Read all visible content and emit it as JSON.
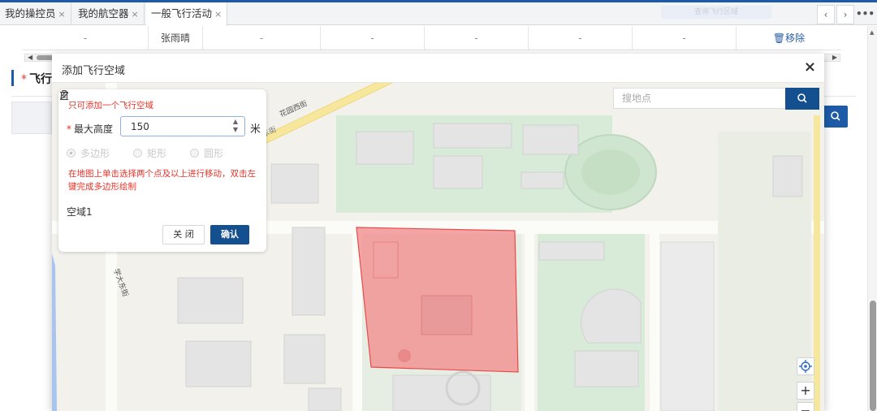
{
  "tabs": [
    {
      "label": "我的操控员",
      "close": "×"
    },
    {
      "label": "我的航空器",
      "close": "×"
    },
    {
      "label": "一般飞行活动",
      "close": "×",
      "active": true
    }
  ],
  "tab_nav": {
    "prev": "‹",
    "next": "›",
    "more": "•••"
  },
  "header_ghost_button": "查询飞行区域",
  "background_table": {
    "row": [
      "-",
      "张雨晴",
      "-",
      "-",
      "-",
      "-",
      "-"
    ],
    "remove_label": "移除"
  },
  "section_title": {
    "required": "*",
    "text": "飞行"
  },
  "modal": {
    "title": "添加飞行空域",
    "close": "×",
    "map_search_placeholder": "搜地点",
    "panel": {
      "hint_single": "只可添加一个飞行空域",
      "height_required": "*",
      "height_label": "最大高度",
      "height_value": "150",
      "height_unit": "米",
      "shape_options": [
        {
          "label": "多边形",
          "selected": true
        },
        {
          "label": "矩形",
          "selected": false
        },
        {
          "label": "圆形",
          "selected": false
        }
      ],
      "draw_hint": "在地图上单击选择两个点及以上进行移动，双击左键完成多边形绘制",
      "airspace_name": "空域1",
      "close_button": "关 闭",
      "confirm_button": "确认"
    },
    "map": {
      "road_labels": [
        "花园西街",
        "花园东街",
        "学大东街"
      ],
      "airspace_fill": "#f28e8e",
      "airspace_stroke": "#e84a4a"
    }
  },
  "colors": {
    "primary": "#14508f",
    "danger": "#e5332a"
  }
}
